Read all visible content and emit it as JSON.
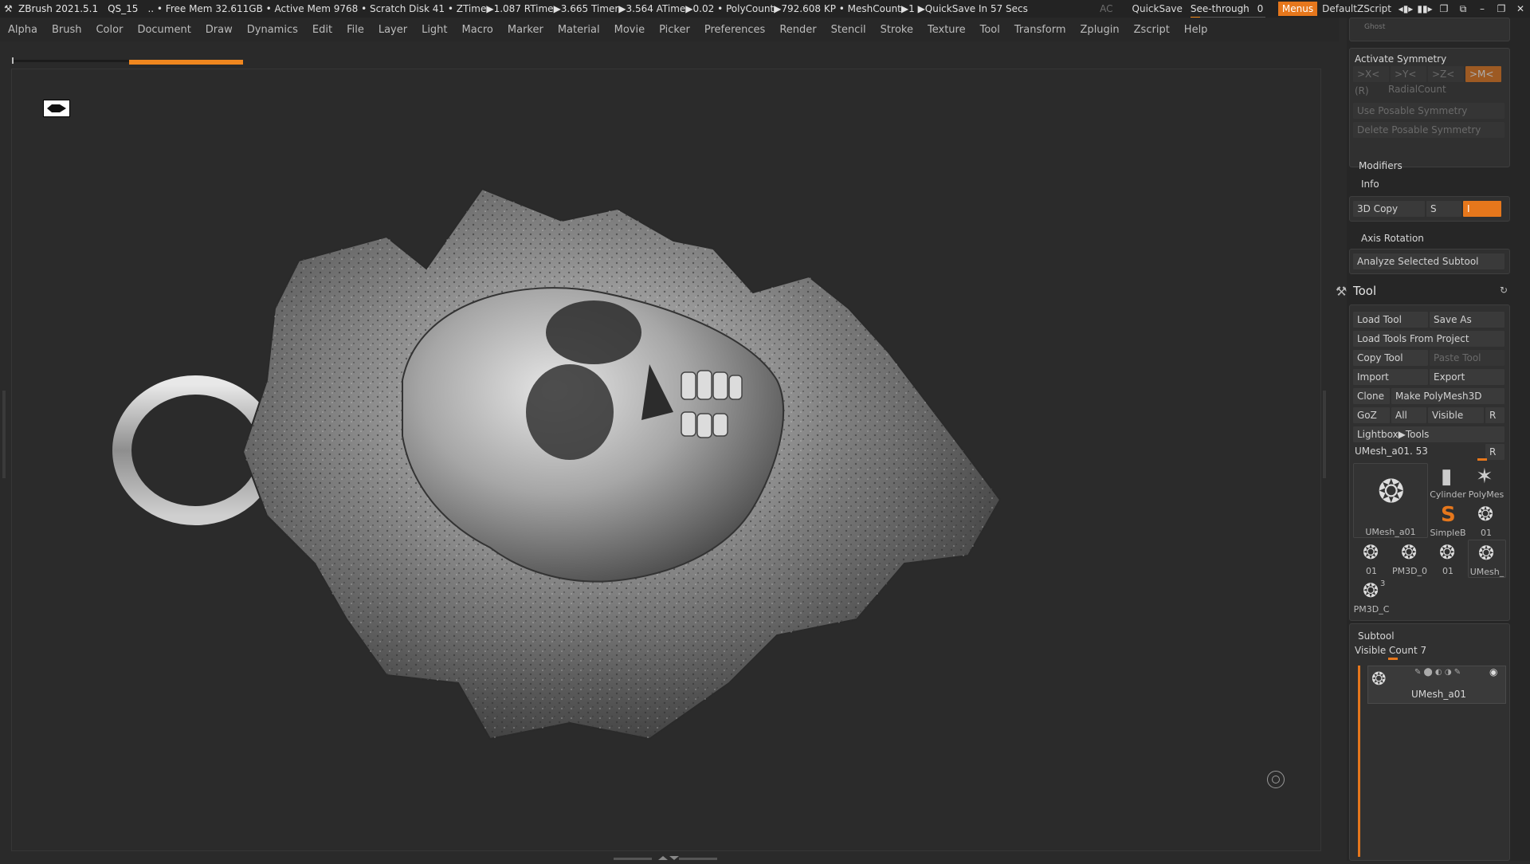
{
  "titlebar": {
    "app": "ZBrush 2021.5.1",
    "project": "QS_15",
    "stats": ".. • Free Mem 32.611GB • Active Mem 9768 • Scratch Disk 41 • ZTime▶1.087 RTime▶3.665 Timer▶3.564 ATime▶0.02 • PolyCount▶792.608 KP • MeshCount▶1 ▶QuickSave In 57 Secs",
    "ac": "AC",
    "quicksave": "QuickSave",
    "see_through_label": "See-through",
    "see_through_value": "0",
    "menus": "Menus",
    "default_zscript": "DefaultZScript"
  },
  "menubar": [
    "Alpha",
    "Brush",
    "Color",
    "Document",
    "Draw",
    "Dynamics",
    "Edit",
    "File",
    "Layer",
    "Light",
    "Macro",
    "Marker",
    "Material",
    "Movie",
    "Picker",
    "Preferences",
    "Render",
    "Stencil",
    "Stroke",
    "Texture",
    "Tool",
    "Transform",
    "Zplugin",
    "Zscript",
    "Help"
  ],
  "panel": {
    "ghost": "Ghost",
    "symmetry": {
      "title": "Activate Symmetry",
      "x": ">X<",
      "y": ">Y<",
      "z": ">Z<",
      "m": ">M<",
      "r": "(R)",
      "radial": "RadialCount",
      "use_posable": "Use Posable Symmetry",
      "delete_posable": "Delete Posable Symmetry"
    },
    "modifiers": "Modifiers",
    "info": "Info",
    "copy3d": "3D Copy",
    "copy3d_s": "S",
    "copy3d_i": "I",
    "axis_rotation": "Axis Rotation",
    "analyze": "Analyze Selected Subtool",
    "tool": {
      "title": "Tool",
      "load_tool": "Load Tool",
      "save_as": "Save As",
      "load_from_project": "Load Tools From Project",
      "copy_tool": "Copy Tool",
      "paste_tool": "Paste Tool",
      "import": "Import",
      "export": "Export",
      "clone": "Clone",
      "make_polymesh": "Make PolyMesh3D",
      "goz": "GoZ",
      "all": "All",
      "visible": "Visible",
      "r": "R",
      "lightbox": "Lightbox▶Tools",
      "current": "UMesh_a01. 53",
      "current_r": "R",
      "thumbs": {
        "main": "UMesh_a01",
        "cylinder": "Cylinder",
        "polymesh": "PolyMes",
        "simpleb": "SimpleB",
        "u1": "01",
        "t1": "01",
        "t2": "PM3D_0",
        "t3": "01",
        "t4": "UMesh_",
        "t5": "PM3D_C",
        "t5_badge": "3"
      }
    },
    "subtool": {
      "title": "Subtool",
      "visible_count": "Visible Count 7",
      "item": "UMesh_a01"
    }
  },
  "colors": {
    "accent": "#e6771c",
    "background": "#2a2a2a",
    "panel": "#262626"
  }
}
